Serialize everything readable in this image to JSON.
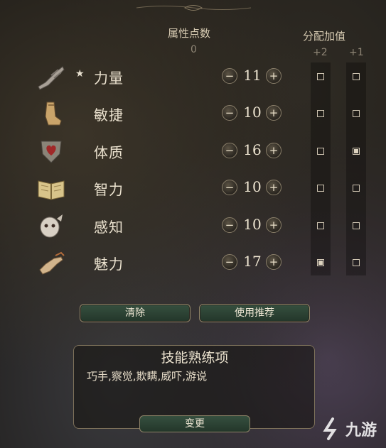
{
  "header": {
    "points_label": "属性点数",
    "points_value": "0",
    "bonus_label": "分配加值",
    "bonus_plus2": "+2",
    "bonus_plus1": "+1"
  },
  "abilities": [
    {
      "name": "力量",
      "value": "11",
      "starred": true,
      "bonus2": false,
      "bonus1": false,
      "icon": "gauntlet-icon"
    },
    {
      "name": "敏捷",
      "value": "10",
      "starred": false,
      "bonus2": false,
      "bonus1": false,
      "icon": "boot-icon"
    },
    {
      "name": "体质",
      "value": "16",
      "starred": false,
      "bonus2": false,
      "bonus1": true,
      "icon": "shield-heart-icon"
    },
    {
      "name": "智力",
      "value": "10",
      "starred": false,
      "bonus2": false,
      "bonus1": false,
      "icon": "book-icon"
    },
    {
      "name": "感知",
      "value": "10",
      "starred": false,
      "bonus2": false,
      "bonus1": false,
      "icon": "owlbear-icon"
    },
    {
      "name": "魅力",
      "value": "17",
      "starred": false,
      "bonus2": true,
      "bonus1": false,
      "icon": "hand-icon"
    }
  ],
  "controls": {
    "minus_glyph": "−",
    "plus_glyph": "+",
    "star_glyph": "★"
  },
  "buttons": {
    "clear": "清除",
    "recommend": "使用推荐",
    "change": "变更"
  },
  "skills": {
    "title": "技能熟练项",
    "list": "巧手,察觉,欺瞒,威吓,游说"
  },
  "watermark": {
    "text": "九游"
  },
  "colors": {
    "button_green": "#2d4536",
    "accent_border": "#8f8468",
    "text": "#e6dcc8"
  }
}
